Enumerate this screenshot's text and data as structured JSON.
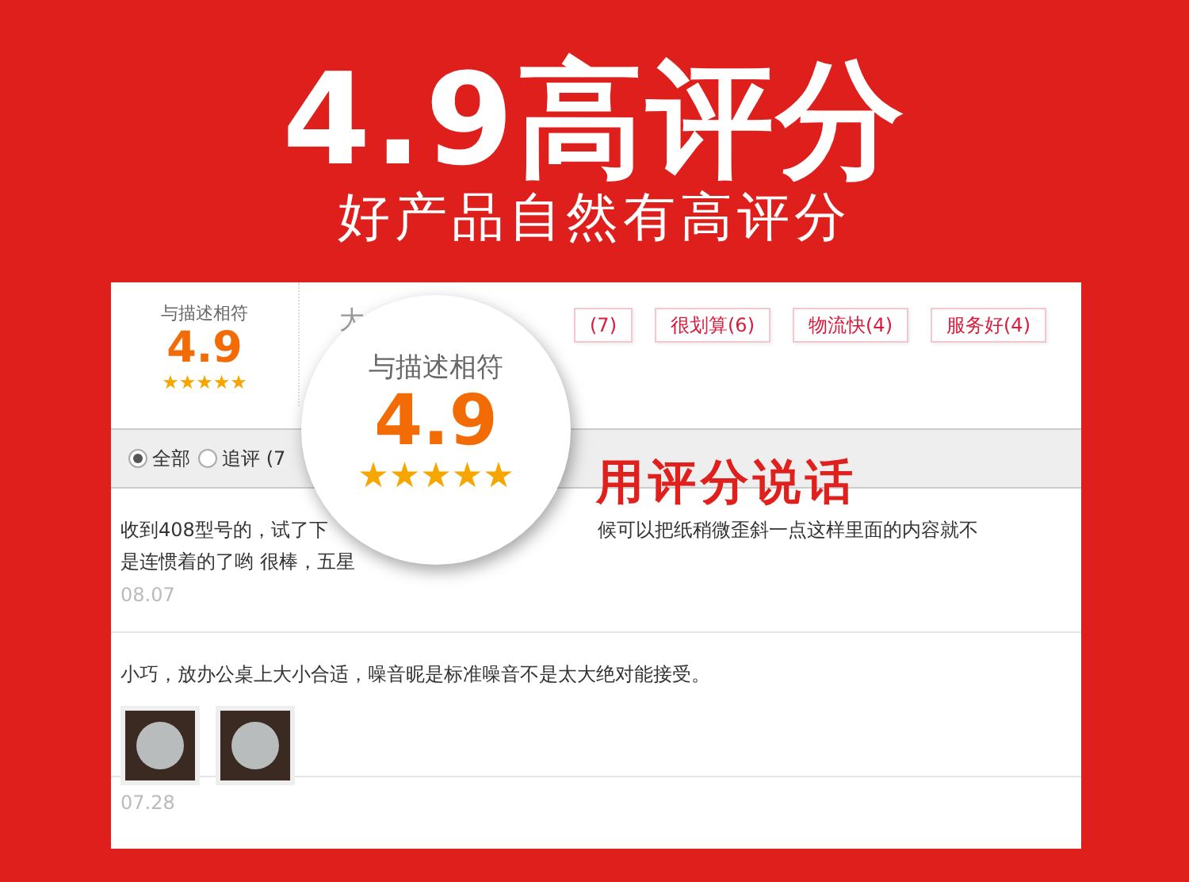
{
  "headline": "4.9高评分",
  "subtitle": "好产品自然有高评分",
  "summary": {
    "label": "与描述相符",
    "score": "4.9",
    "stars": 5
  },
  "cut_text": "大",
  "tags": [
    {
      "label": "(7)"
    },
    {
      "label": "很划算(6)"
    },
    {
      "label": "物流快(4)"
    },
    {
      "label": "服务好(4)"
    }
  ],
  "filters": [
    {
      "label": "全部",
      "selected": true
    },
    {
      "label": "追评 (7",
      "selected": false
    }
  ],
  "reviews": [
    {
      "lines": [
        [
          "收到408型号的，试了下",
          "候可以把纸稍微歪斜一点这样里面的内容就不"
        ],
        [
          "是连惯着的了哟 很棒，五星"
        ]
      ],
      "date": "08.07"
    },
    {
      "lines": [
        [
          "小巧，放办公桌上大小合适，噪音昵是标准噪音不是太大绝对能接受。"
        ]
      ],
      "photos": [
        {
          "kind": "photo"
        },
        {
          "kind": "photo"
        }
      ],
      "date": "07.28"
    }
  ],
  "magnifier": {
    "label": "与描述相符",
    "score": "4.9",
    "stars": 5
  },
  "callout": "用评分说话"
}
